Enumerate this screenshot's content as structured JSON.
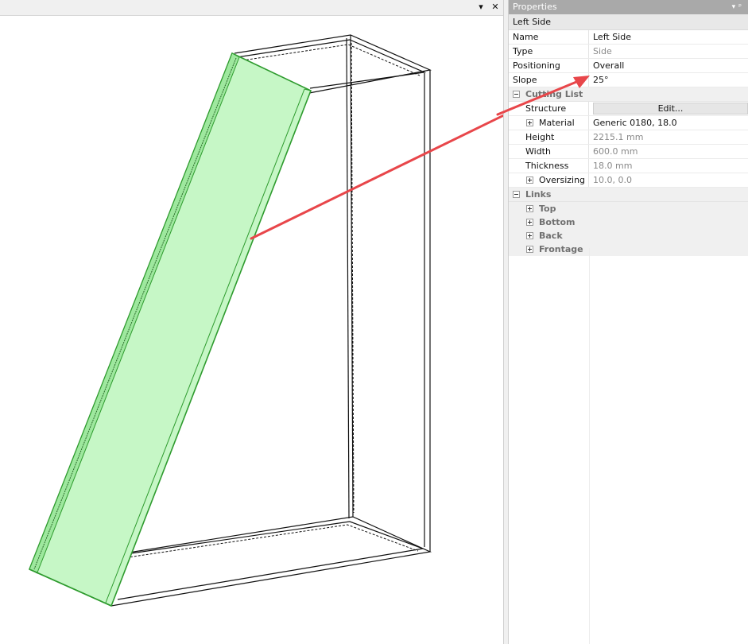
{
  "viewport": {
    "dropdown_glyph": "▾",
    "close_glyph": "✕"
  },
  "properties_panel": {
    "title": "Properties",
    "dropdown_glyph": "▾",
    "pin_glyph": "ᵖ",
    "object_name": "Left Side",
    "rows": {
      "name": {
        "label": "Name",
        "value": "Left Side"
      },
      "type": {
        "label": "Type",
        "value": "Side"
      },
      "positioning": {
        "label": "Positioning",
        "value": "Overall"
      },
      "slope": {
        "label": "Slope",
        "value": "25°"
      }
    },
    "cutting_list": {
      "label": "Cutting List",
      "structure": {
        "label": "Structure",
        "button": "Edit..."
      },
      "material": {
        "label": "Material",
        "value": "Generic 0180, 18.0"
      },
      "height": {
        "label": "Height",
        "value": "2215.1 mm"
      },
      "width": {
        "label": "Width",
        "value": "600.0 mm"
      },
      "thickness": {
        "label": "Thickness",
        "value": "18.0 mm"
      },
      "oversizing": {
        "label": "Oversizing",
        "value": "10.0, 0.0"
      }
    },
    "links": {
      "label": "Links",
      "items": [
        "Top",
        "Bottom",
        "Back",
        "Frontage"
      ]
    }
  },
  "colors": {
    "panel_fill": "#c6f7c6",
    "panel_edge": "#2e9b2e",
    "annotation_arrow": "#e8464a",
    "properties_header": "#a9a9a9"
  }
}
